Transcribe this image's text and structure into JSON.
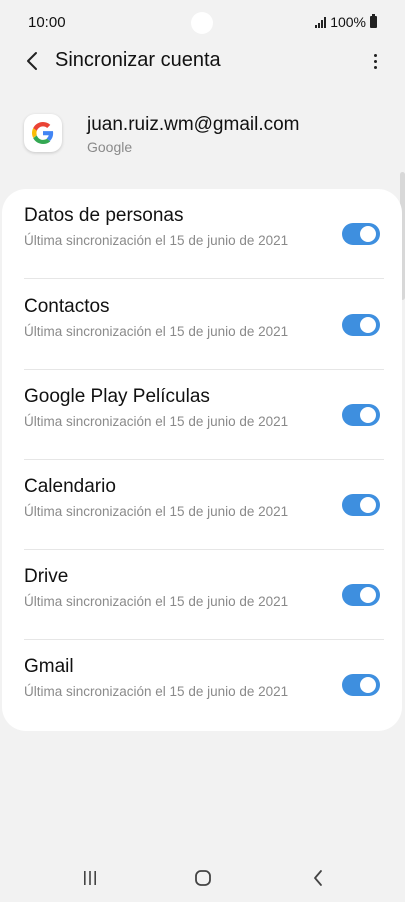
{
  "status_bar": {
    "time": "10:00",
    "battery": "100%"
  },
  "header": {
    "title": "Sincronizar cuenta"
  },
  "account": {
    "email": "juan.ruiz.wm@gmail.com",
    "type": "Google"
  },
  "sync_items": [
    {
      "title": "Datos de personas",
      "subtitle": "Última sincronización el 15 de junio de 2021",
      "enabled": true
    },
    {
      "title": "Contactos",
      "subtitle": "Última sincronización el 15 de junio de 2021",
      "enabled": true
    },
    {
      "title": "Google Play Películas",
      "subtitle": "Última sincronización el 15 de junio de 2021",
      "enabled": true
    },
    {
      "title": "Calendario",
      "subtitle": "Última sincronización el 15 de junio de 2021",
      "enabled": true
    },
    {
      "title": "Drive",
      "subtitle": "Última sincronización el 15 de junio de 2021",
      "enabled": true
    },
    {
      "title": "Gmail",
      "subtitle": "Última sincronización el 15 de junio de 2021",
      "enabled": true
    }
  ],
  "icons": {
    "back": "chevron-left-icon",
    "more": "more-vertical-icon",
    "google": "google-logo-icon",
    "recents": "recents-icon",
    "home": "home-icon",
    "nav_back": "nav-back-icon"
  },
  "colors": {
    "toggle_on": "#3e8fdf",
    "background": "#f2f2f2"
  }
}
